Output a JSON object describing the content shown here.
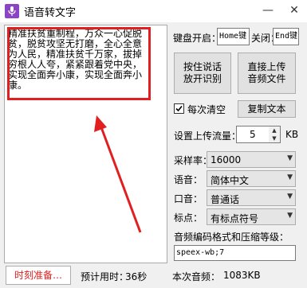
{
  "window": {
    "title": "语音转文字",
    "minimize": "—",
    "close": "✕"
  },
  "transcript": {
    "text": "精准扶贫重制程，万众一心促脱贫，脱贫攻坚无打磨，全心全意为人民，精准扶贫千万家，拔掉穷根人人夸，紧紧跟着党中央，实现全面奔小康，实现全面奔小康。"
  },
  "status": {
    "button_label": "时刻准备…",
    "estimate_label": "预计用时：",
    "estimate_value": "36秒"
  },
  "hotkeys": {
    "label_open": "键盘开启：",
    "open_key": "Home键",
    "label_close": "关闭：",
    "close_key": "End键"
  },
  "actions": {
    "hold_button": "按住说话\n放开识别",
    "upload_button": "直接上传\n音频文件",
    "copy_button": "复制文本"
  },
  "clear_option": {
    "label": "每次清空",
    "checked": true
  },
  "upload_rate": {
    "label": "设置上传流量：",
    "value": "5",
    "unit": "KB"
  },
  "settings": [
    {
      "label": "采样率：",
      "value": "16000"
    },
    {
      "label": "语音：",
      "value": "简体中文"
    },
    {
      "label": "口音：",
      "value": "普通话"
    },
    {
      "label": "标点：",
      "value": "有标点符号"
    }
  ],
  "codec": {
    "label": "音频编码格式和压缩等级：",
    "value": "speex-wb;7"
  },
  "audio": {
    "label": "本次音频：",
    "value": "1083KB"
  },
  "colors": {
    "accent": "#e02020",
    "icon": "#8b44c4"
  },
  "icons": {
    "app": "microphone-icon",
    "minimize": "minimize-icon",
    "close": "close-icon"
  }
}
